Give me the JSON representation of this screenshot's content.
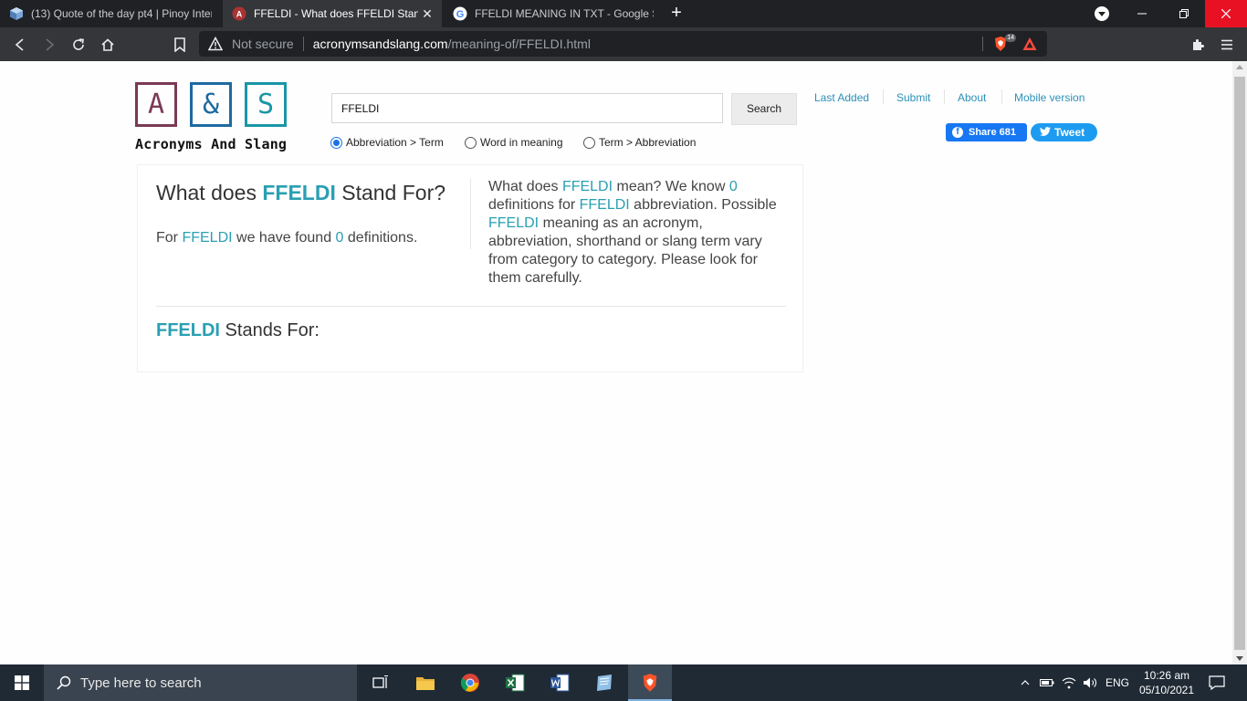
{
  "browser": {
    "tabs": [
      {
        "title": "(13) Quote of the day pt4 | Pinoy Inter"
      },
      {
        "title": "FFELDI - What does FFELDI Stand",
        "close": "✕"
      },
      {
        "title": "FFELDI MEANING IN TXT - Google Sea"
      }
    ],
    "new_tab": "+",
    "address": {
      "security": "Not secure",
      "host": "acronymsandslang.com",
      "path": "/meaning-of/FFELDI.html"
    },
    "brave_badge": "14"
  },
  "site": {
    "logo": {
      "letters": [
        "A",
        "&",
        "S"
      ],
      "colors": [
        "#7a3a55",
        "#1d6aa0",
        "#1996a6"
      ],
      "tagline": "Acronyms And Slang"
    },
    "search": {
      "value": "FFELDI",
      "button": "Search",
      "options": [
        {
          "label": "Abbreviation > Term",
          "checked": true
        },
        {
          "label": "Word in meaning",
          "checked": false
        },
        {
          "label": "Term > Abbreviation",
          "checked": false
        }
      ]
    },
    "nav": [
      "Last Added",
      "Submit",
      "About",
      "Mobile version"
    ],
    "share": {
      "facebook": "Share 681",
      "tweet": "Tweet"
    }
  },
  "card": {
    "term": "FFELDI",
    "title_pre": "What does ",
    "title_post": " Stand For?",
    "sub_pre": "For ",
    "sub_mid": " we have found ",
    "count": "0",
    "sub_post": " definitions.",
    "desc_1": "What does ",
    "desc_2": " mean? We know ",
    "desc_3": " definitions for ",
    "desc_4": " abbreviation. Possible ",
    "desc_5": " meaning as an acronym, abbreviation, shorthand or slang term vary from category to category. Please look for them carefully.",
    "stands_for": " Stands For:"
  },
  "taskbar": {
    "search_placeholder": "Type here to search",
    "language": "ENG",
    "time": "10:26 am",
    "date": "05/10/2021"
  }
}
